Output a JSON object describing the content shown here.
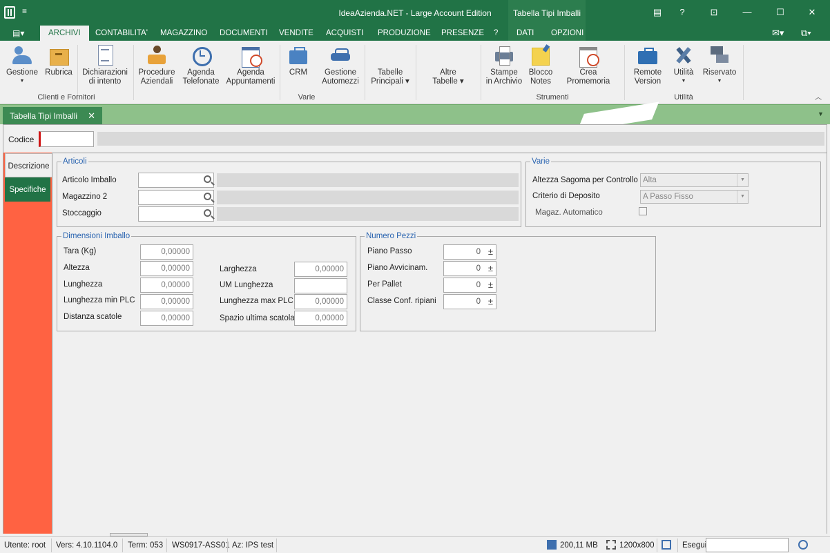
{
  "window": {
    "title": "IdeaAzienda.NET - Large Account Edition",
    "context_tab_title": "Tabella Tipi Imballi",
    "help": "?"
  },
  "menu": {
    "items": [
      "ARCHIVI",
      "CONTABILITA'",
      "MAGAZZINO",
      "DOCUMENTI",
      "VENDITE",
      "ACQUISTI",
      "PRODUZIONE",
      "PRESENZE",
      "?",
      "DATI",
      "OPZIONI"
    ],
    "active": "ARCHIVI"
  },
  "ribbon": {
    "buttons": [
      {
        "label": "Gestione",
        "icon": "people-icon",
        "dropdown": true
      },
      {
        "label": "Rubrica",
        "icon": "box-icon"
      },
      {
        "label": "Dichiarazioni di intento",
        "icon": "document-icon"
      },
      {
        "label": "Procedure Aziendali",
        "icon": "person-icon"
      },
      {
        "label": "Agenda Telefonate",
        "icon": "clock-icon"
      },
      {
        "label": "Agenda Appuntamenti",
        "icon": "calendar-icon"
      },
      {
        "label": "CRM",
        "icon": "briefcase-icon"
      },
      {
        "label": "Gestione Automezzi",
        "icon": "car-icon"
      },
      {
        "label": "Tabelle Principali",
        "dropdown": true
      },
      {
        "label": "Altre Tabelle",
        "dropdown": true
      },
      {
        "label": "Stampe in Archivio",
        "icon": "printer-icon"
      },
      {
        "label": "Blocco Notes",
        "icon": "note-icon"
      },
      {
        "label": "Crea Promemoria",
        "icon": "reminder-icon"
      },
      {
        "label": "Remote Version",
        "icon": "remote-icon",
        "dropdown": true
      },
      {
        "label": "Utilità",
        "icon": "tools-icon",
        "dropdown": true
      },
      {
        "label": "Riservato",
        "icon": "reserved-icon",
        "dropdown": true
      }
    ],
    "groups": [
      "Clienti e Fornitori",
      "Varie",
      "Strumenti",
      "Utilità"
    ]
  },
  "doc_tab": {
    "label": "Tabella Tipi Imballi",
    "close": "✕"
  },
  "form": {
    "codice_label": "Codice",
    "codice_value": "",
    "side_tabs": [
      "Descrizione",
      "Specifiche"
    ],
    "articoli": {
      "legend": "Articoli",
      "fields": [
        "Articolo Imballo",
        "Magazzino 2",
        "Stoccaggio"
      ]
    },
    "varie": {
      "legend": "Varie",
      "altezza_label": "Altezza Sagoma per Controllo",
      "altezza_value": "Alta",
      "criterio_label": "Criterio di Deposito",
      "criterio_value": "A Passo Fisso",
      "magaz_label": "Magaz. Automatico"
    },
    "dimensioni": {
      "legend": "Dimensioni Imballo",
      "left": [
        {
          "label": "Tara (Kg)",
          "value": "0,00000"
        },
        {
          "label": "Altezza",
          "value": "0,00000"
        },
        {
          "label": "Lunghezza",
          "value": "0,00000"
        },
        {
          "label": "Lunghezza min PLC",
          "value": "0,00000"
        },
        {
          "label": "Distanza scatole",
          "value": "0,00000"
        }
      ],
      "right": [
        {
          "label": "Larghezza",
          "value": "0,00000"
        },
        {
          "label": "UM Lunghezza",
          "value": ""
        },
        {
          "label": "Lunghezza max PLC",
          "value": "0,00000"
        },
        {
          "label": "Spazio ultima scatola",
          "value": "0,00000"
        }
      ]
    },
    "numero_pezzi": {
      "legend": "Numero Pezzi",
      "rows": [
        {
          "label": "Piano Passo",
          "value": "0"
        },
        {
          "label": "Piano Avvicinam.",
          "value": "0"
        },
        {
          "label": "Per Pallet",
          "value": "0"
        },
        {
          "label": "Classe Conf. ripiani",
          "value": "0"
        }
      ],
      "spin_symbol": "±"
    }
  },
  "status": {
    "user": "Utente: root",
    "version": "Vers: 4.10.1104.0",
    "term": "Term: 053",
    "workstation": "WS0917-ASS01",
    "az": "Az: IPS test",
    "memory": "200,11 MB",
    "resolution": "1200x800",
    "esegui": "Esegui"
  }
}
